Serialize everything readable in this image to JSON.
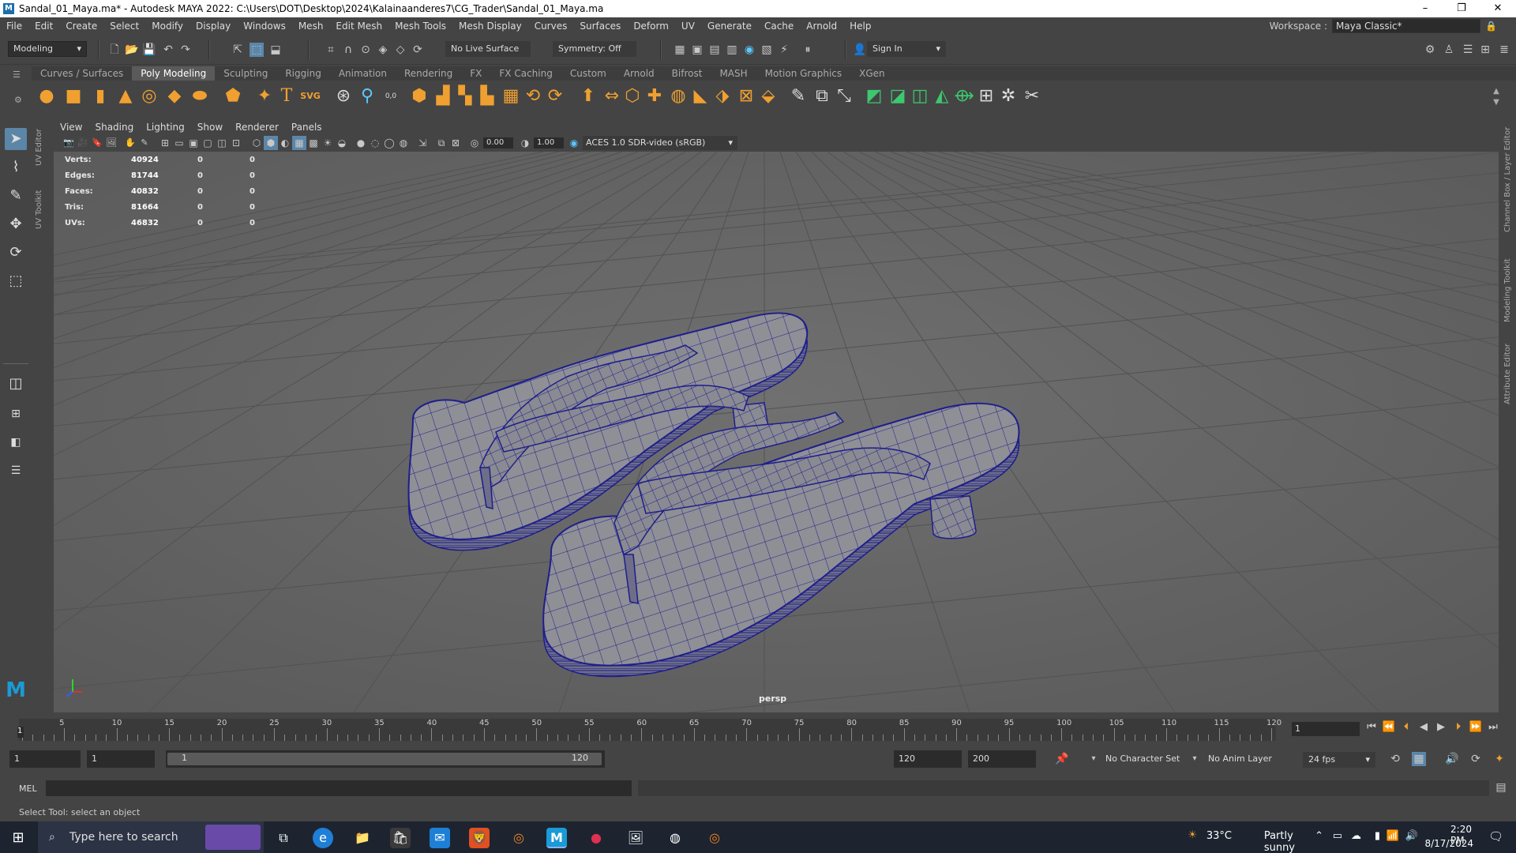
{
  "window": {
    "title": "Sandal_01_Maya.ma* - Autodesk MAYA 2022: C:\\Users\\DOT\\Desktop\\2024\\Kalainaanderes7\\CG_Trader\\Sandal_01_Maya.ma",
    "minimize": "–",
    "restore": "❐",
    "close": "✕"
  },
  "menubar": {
    "items": [
      "File",
      "Edit",
      "Create",
      "Select",
      "Modify",
      "Display",
      "Windows",
      "Mesh",
      "Edit Mesh",
      "Mesh Tools",
      "Mesh Display",
      "Curves",
      "Surfaces",
      "Deform",
      "UV",
      "Generate",
      "Cache",
      "Arnold",
      "Help"
    ],
    "workspace_label": "Workspace :",
    "workspace_value": "Maya Classic*"
  },
  "statusline": {
    "mode": "Modeling",
    "live_surface": "No Live Surface",
    "symmetry": "Symmetry: Off",
    "sign_in": "Sign In"
  },
  "shelf": {
    "tabs": [
      "Curves / Surfaces",
      "Poly Modeling",
      "Sculpting",
      "Rigging",
      "Animation",
      "Rendering",
      "FX",
      "FX Caching",
      "Custom",
      "Arnold",
      "Bifrost",
      "MASH",
      "Motion Graphics",
      "XGen"
    ],
    "active_tab": "Poly Modeling",
    "text_icons": {
      "t": "T",
      "svg": "SVG",
      "num": "0,0"
    }
  },
  "sidetabs": {
    "left": [
      "UV Editor",
      "UV Toolkit"
    ],
    "right": [
      "Channel Box / Layer Editor",
      "Modeling Toolkit",
      "Attribute Editor"
    ]
  },
  "viewport": {
    "menu": [
      "View",
      "Shading",
      "Lighting",
      "Show",
      "Renderer",
      "Panels"
    ],
    "exposure": "0.00",
    "gamma": "1.00",
    "color_space": "ACES 1.0 SDR-video (sRGB)",
    "camera": "persp",
    "hud": [
      {
        "label": "Verts:",
        "value": "40924",
        "a": "0",
        "b": "0"
      },
      {
        "label": "Edges:",
        "value": "81744",
        "a": "0",
        "b": "0"
      },
      {
        "label": "Faces:",
        "value": "40832",
        "a": "0",
        "b": "0"
      },
      {
        "label": "Tris:",
        "value": "81664",
        "a": "0",
        "b": "0"
      },
      {
        "label": "UVs:",
        "value": "46832",
        "a": "0",
        "b": "0"
      }
    ],
    "wire_color": "#1e1e8c"
  },
  "timeline": {
    "ticks": [
      5,
      10,
      15,
      20,
      25,
      30,
      35,
      40,
      45,
      50,
      55,
      60,
      65,
      70,
      75,
      80,
      85,
      90,
      95,
      100,
      105,
      110,
      115,
      120
    ],
    "current_frame_marker": "1",
    "current_frame": "1"
  },
  "range": {
    "start": "1",
    "playback_start": "1",
    "slider_start": "1",
    "slider_end": "120",
    "playback_end": "120",
    "end": "200",
    "character_set": "No Character Set",
    "anim_layer": "No Anim Layer",
    "fps": "24 fps"
  },
  "command": {
    "label": "MEL"
  },
  "help_line": "Select Tool: select an object",
  "taskbar": {
    "search_placeholder": "Type here to search",
    "weather_temp": "33°C",
    "weather_desc": "Partly sunny",
    "time": "2:20 PM",
    "date": "8/17/2024"
  }
}
